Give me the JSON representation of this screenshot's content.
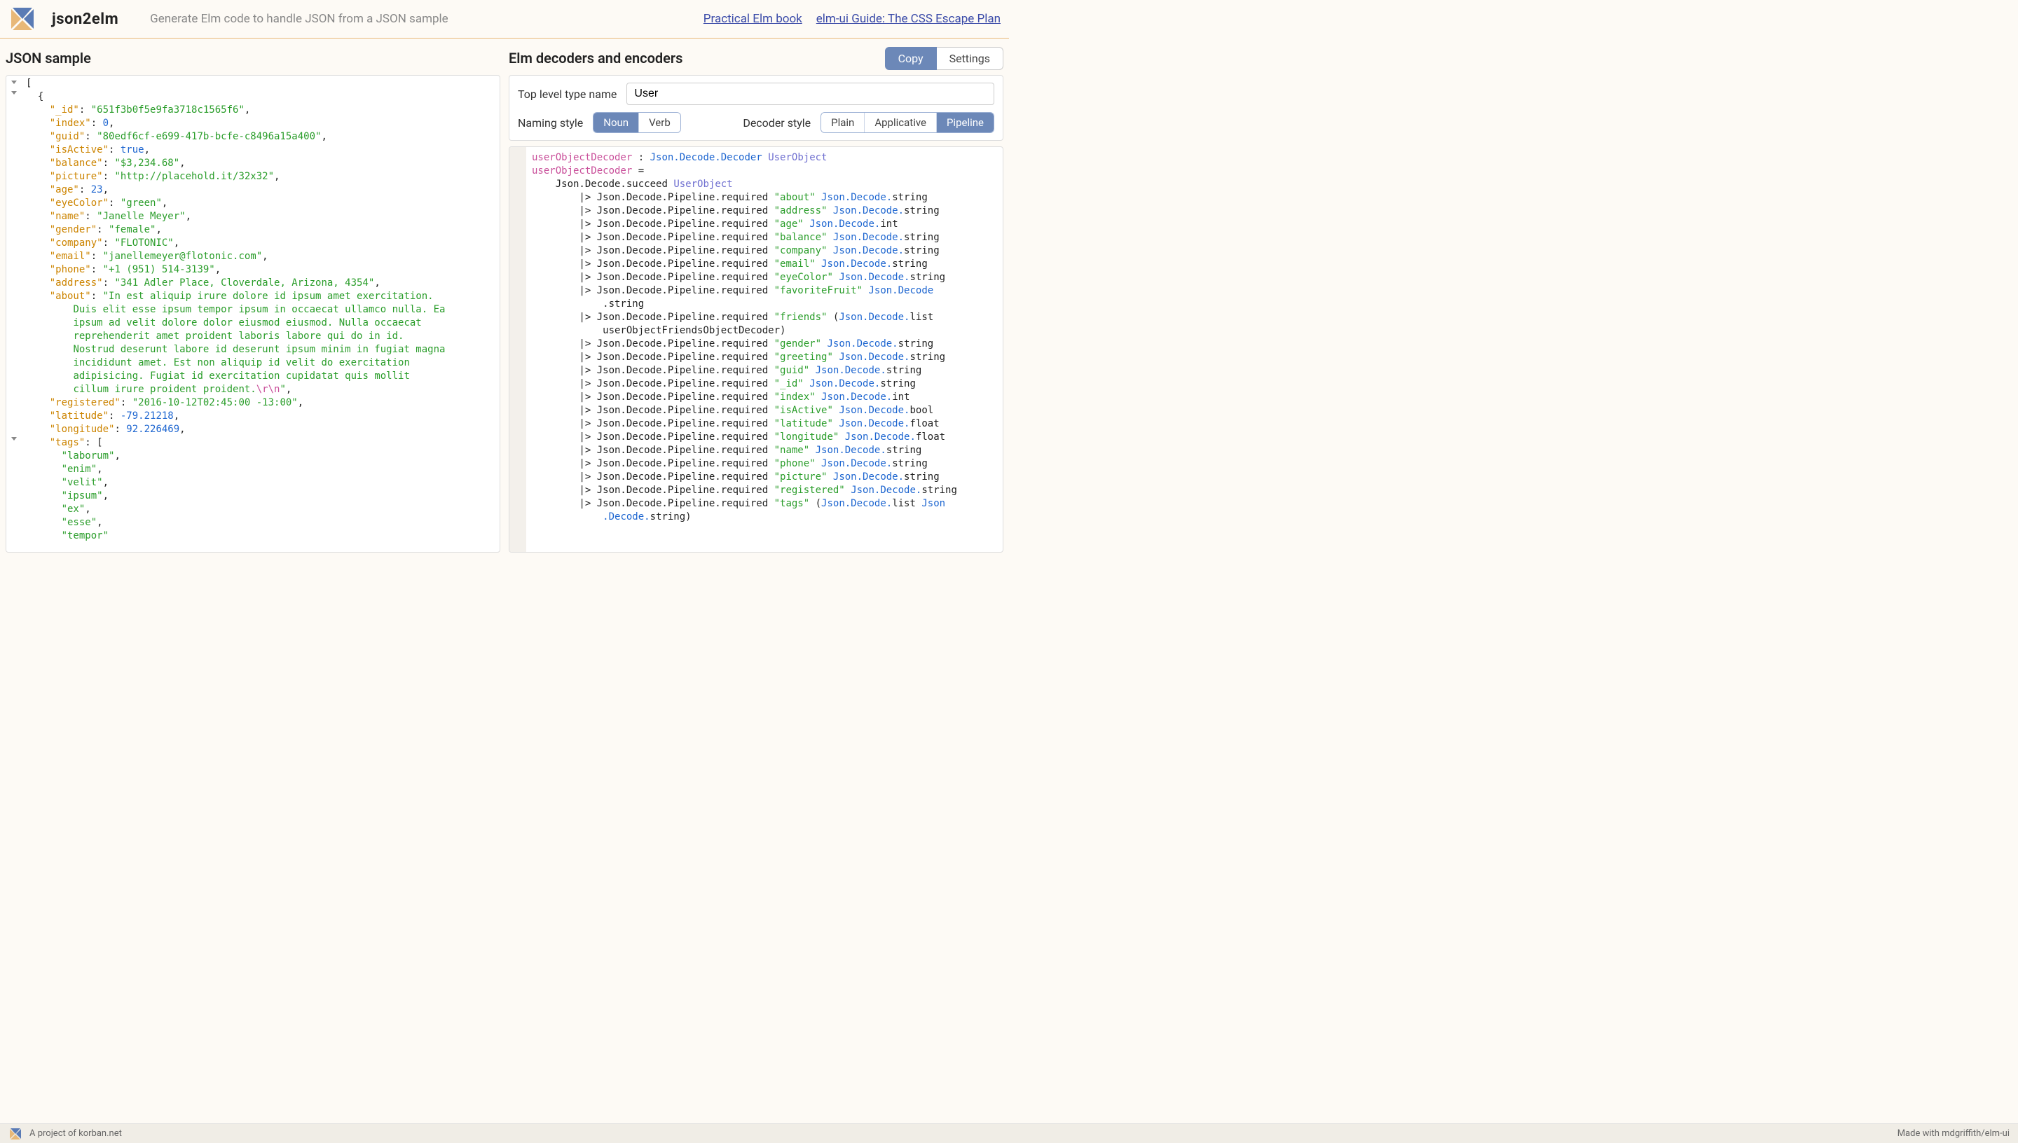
{
  "header": {
    "brand": "json2elm",
    "tagline": "Generate Elm code to handle JSON from a JSON sample",
    "links": [
      "Practical Elm book",
      "elm-ui Guide: The CSS Escape Plan"
    ]
  },
  "left": {
    "title": "JSON sample",
    "json": {
      "_id": "651f3b0f5e9fa3718c1565f6",
      "index": 0,
      "guid": "80edf6cf-e699-417b-bcfe-c8496a15a400",
      "isActive": true,
      "balance": "$3,234.68",
      "picture": "http://placehold.it/32x32",
      "age": 23,
      "eyeColor": "green",
      "name": "Janelle Meyer",
      "gender": "female",
      "company": "FLOTONIC",
      "email": "janellemeyer@flotonic.com",
      "phone": "+1 (951) 514-3139",
      "address": "341 Adler Place, Cloverdale, Arizona, 4354",
      "about": "In est aliquip irure dolore id ipsum amet exercitation. Duis elit esse ipsum tempor ipsum in occaecat ullamco nulla. Ea ipsum ad velit dolore dolor eiusmod eiusmod. Nulla occaecat reprehenderit amet proident laboris labore qui do in id. Nostrud deserunt labore id deserunt ipsum minim in fugiat magna incididunt amet. Est non aliquip id velit do exercitation adipisicing. Fugiat id exercitation cupidatat quis mollit cillum irure proident proident.",
      "about_escape": "\\r\\n",
      "registered": "2016-10-12T02:45:00 -13:00",
      "latitude": -79.21218,
      "longitude": 92.226469,
      "tags": [
        "laborum",
        "enim",
        "velit",
        "ipsum",
        "ex",
        "esse",
        "tempor"
      ]
    }
  },
  "right": {
    "title": "Elm decoders and encoders",
    "tabs": {
      "copy": "Copy",
      "settings": "Settings",
      "active": "copy"
    },
    "settings": {
      "type_label": "Top level type name",
      "type_value": "User",
      "naming_label": "Naming style",
      "naming_options": [
        "Noun",
        "Verb"
      ],
      "naming_active": "Noun",
      "decoder_label": "Decoder style",
      "decoder_options": [
        "Plain",
        "Applicative",
        "Pipeline"
      ],
      "decoder_active": "Pipeline"
    },
    "elm": {
      "decoder_name": "userObjectDecoder",
      "type_sig": "Json.Decode.Decoder",
      "type_name": "UserObject",
      "succeed": "Json.Decode.succeed",
      "pipe_prefix": "Json.Decode.Pipeline.required",
      "string_dec": "Json.Decode.string",
      "int_dec": "Json.Decode.int",
      "bool_dec": "Json.Decode.bool",
      "float_dec": "Json.Decode.float",
      "list_dec": "Json.Decode.list",
      "friends_dec": "userObjectFriendsObjectDecoder",
      "fields": [
        {
          "name": "about",
          "dec": "string"
        },
        {
          "name": "address",
          "dec": "string"
        },
        {
          "name": "age",
          "dec": "int"
        },
        {
          "name": "balance",
          "dec": "string"
        },
        {
          "name": "company",
          "dec": "string"
        },
        {
          "name": "email",
          "dec": "string"
        },
        {
          "name": "eyeColor",
          "dec": "string"
        },
        {
          "name": "favoriteFruit",
          "dec": "string_wrap"
        },
        {
          "name": "friends",
          "dec": "friends"
        },
        {
          "name": "gender",
          "dec": "string"
        },
        {
          "name": "greeting",
          "dec": "string"
        },
        {
          "name": "guid",
          "dec": "string"
        },
        {
          "name": "_id",
          "dec": "string"
        },
        {
          "name": "index",
          "dec": "int"
        },
        {
          "name": "isActive",
          "dec": "bool"
        },
        {
          "name": "latitude",
          "dec": "float"
        },
        {
          "name": "longitude",
          "dec": "float"
        },
        {
          "name": "name",
          "dec": "string"
        },
        {
          "name": "phone",
          "dec": "string"
        },
        {
          "name": "picture",
          "dec": "string"
        },
        {
          "name": "registered",
          "dec": "string"
        },
        {
          "name": "tags",
          "dec": "taglist"
        }
      ]
    }
  },
  "footer": {
    "left": "A project of korban.net",
    "right": "Made with mdgriffith/elm-ui"
  },
  "colors": {
    "accent": "#6c88b8",
    "key": "#cc8400",
    "string": "#2a9d2a",
    "number": "#1e66d0"
  }
}
